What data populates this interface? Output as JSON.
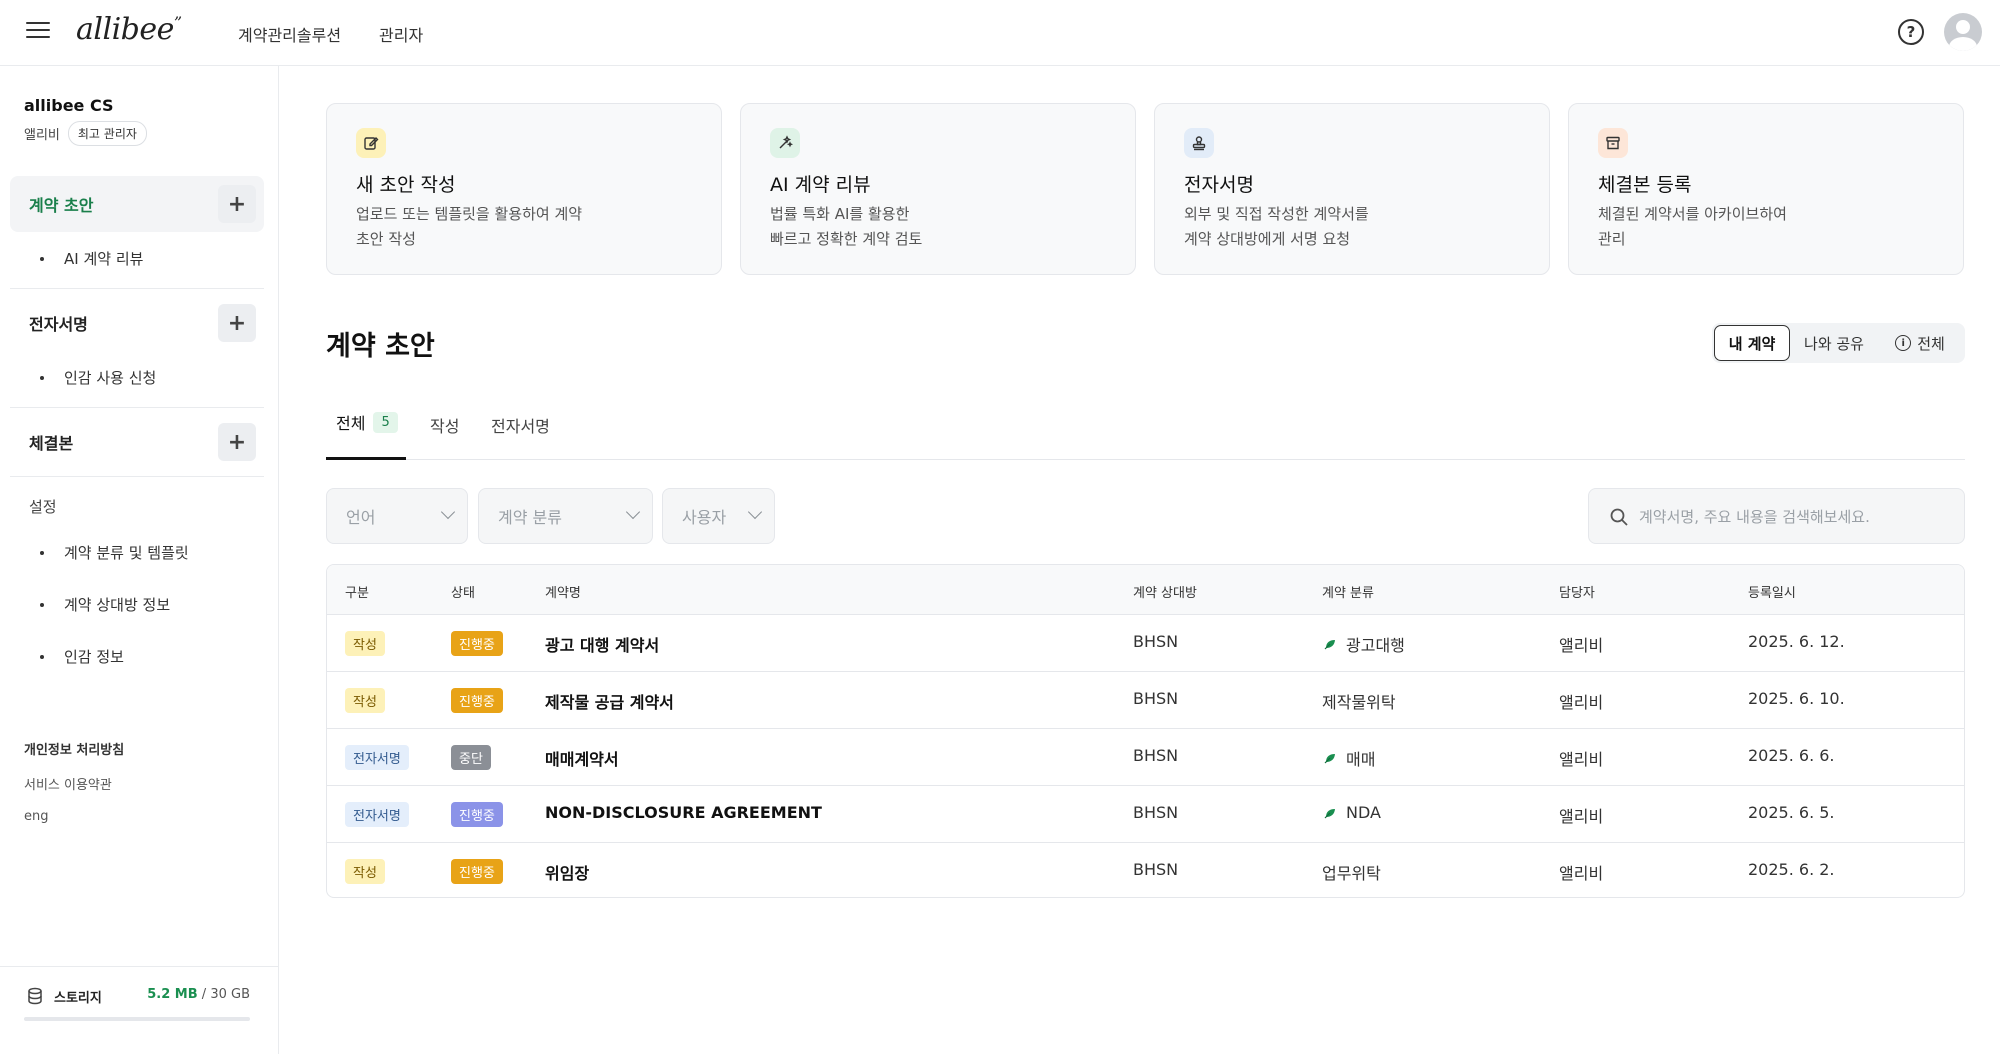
{
  "header": {
    "logo": "allibee",
    "logo_mark": "”",
    "nav": [
      "계약관리솔루션",
      "관리자"
    ]
  },
  "sidebar": {
    "org_name": "allibee CS",
    "user_name": "앨리비",
    "role": "최고 관리자",
    "sections": [
      {
        "label": "계약 초안",
        "sub": [
          "AI 계약 리뷰"
        ]
      },
      {
        "label": "전자서명",
        "sub": [
          "인감 사용 신청"
        ]
      },
      {
        "label": "체결본",
        "sub": []
      }
    ],
    "settings_label": "설정",
    "settings_items": [
      "계약 분류 및 템플릿",
      "계약 상대방 정보",
      "인감 정보"
    ],
    "footer_links": [
      "개인정보 처리방침",
      "서비스 이용약관",
      "eng"
    ],
    "storage": {
      "label": "스토리지",
      "used": "5.2 MB",
      "separator": "/",
      "total": "30 GB",
      "fraction": 0.0002
    }
  },
  "cards": [
    {
      "title": "새 초안 작성",
      "desc": "업로드 또는 템플릿을 활용하여 계약\n초안 작성",
      "icon": "edit-icon",
      "color": "#fdf1b8"
    },
    {
      "title": "AI 계약 리뷰",
      "desc": "법률 특화 AI를 활용한\n빠르고 정확한 계약 검토",
      "icon": "sparkle-icon",
      "color": "#dff3e7"
    },
    {
      "title": "전자서명",
      "desc": "외부 및 직접 작성한 계약서를\n계약 상대방에게 서명 요청",
      "icon": "stamp-icon",
      "color": "#e2ecf8"
    },
    {
      "title": "체결본 등록",
      "desc": "체결된 계약서를 아카이브하여\n관리",
      "icon": "archive-icon",
      "color": "#fde6d8"
    }
  ],
  "main": {
    "section_title": "계약 초안",
    "segments": [
      "내 계약",
      "나와 공유",
      "전체"
    ],
    "tabs": [
      {
        "label": "전체",
        "count": "5"
      },
      {
        "label": "작성"
      },
      {
        "label": "전자서명"
      }
    ],
    "filters": [
      "언어",
      "계약 분류",
      "사용자"
    ],
    "search_placeholder": "계약서명, 주요 내용을 검색해보세요."
  },
  "table": {
    "columns": [
      "구분",
      "상태",
      "계약명",
      "계약 상대방",
      "계약 분류",
      "담당자",
      "등록일시"
    ],
    "rows": [
      {
        "type": "작성",
        "status": "진행중",
        "name": "광고 대행 계약서",
        "party": "BHSN",
        "category": "광고대행",
        "category_icon": true,
        "owner": "앨리비",
        "date": "2025. 6. 12."
      },
      {
        "type": "작성",
        "status": "진행중",
        "name": "제작물 공급 계약서",
        "party": "BHSN",
        "category": "제작물위탁",
        "category_icon": false,
        "owner": "앨리비",
        "date": "2025. 6. 10."
      },
      {
        "type": "전자서명",
        "status": "중단",
        "name": "매매계약서",
        "party": "BHSN",
        "category": "매매",
        "category_icon": true,
        "owner": "앨리비",
        "date": "2025. 6. 6."
      },
      {
        "type": "전자서명",
        "status": "진행중",
        "name": "NON-DISCLOSURE AGREEMENT",
        "party": "BHSN",
        "category": "NDA",
        "category_icon": true,
        "owner": "앨리비",
        "date": "2025. 6. 5."
      },
      {
        "type": "작성",
        "status": "진행중",
        "name": "위임장",
        "party": "BHSN",
        "category": "업무위탁",
        "category_icon": false,
        "owner": "앨리비",
        "date": "2025. 6. 2."
      }
    ]
  },
  "colors": {
    "accent": "#1a7f4b",
    "status_progress": "#e8a317",
    "status_stopped": "#8b8f96",
    "status_progress_sign": "#8b93e8"
  }
}
